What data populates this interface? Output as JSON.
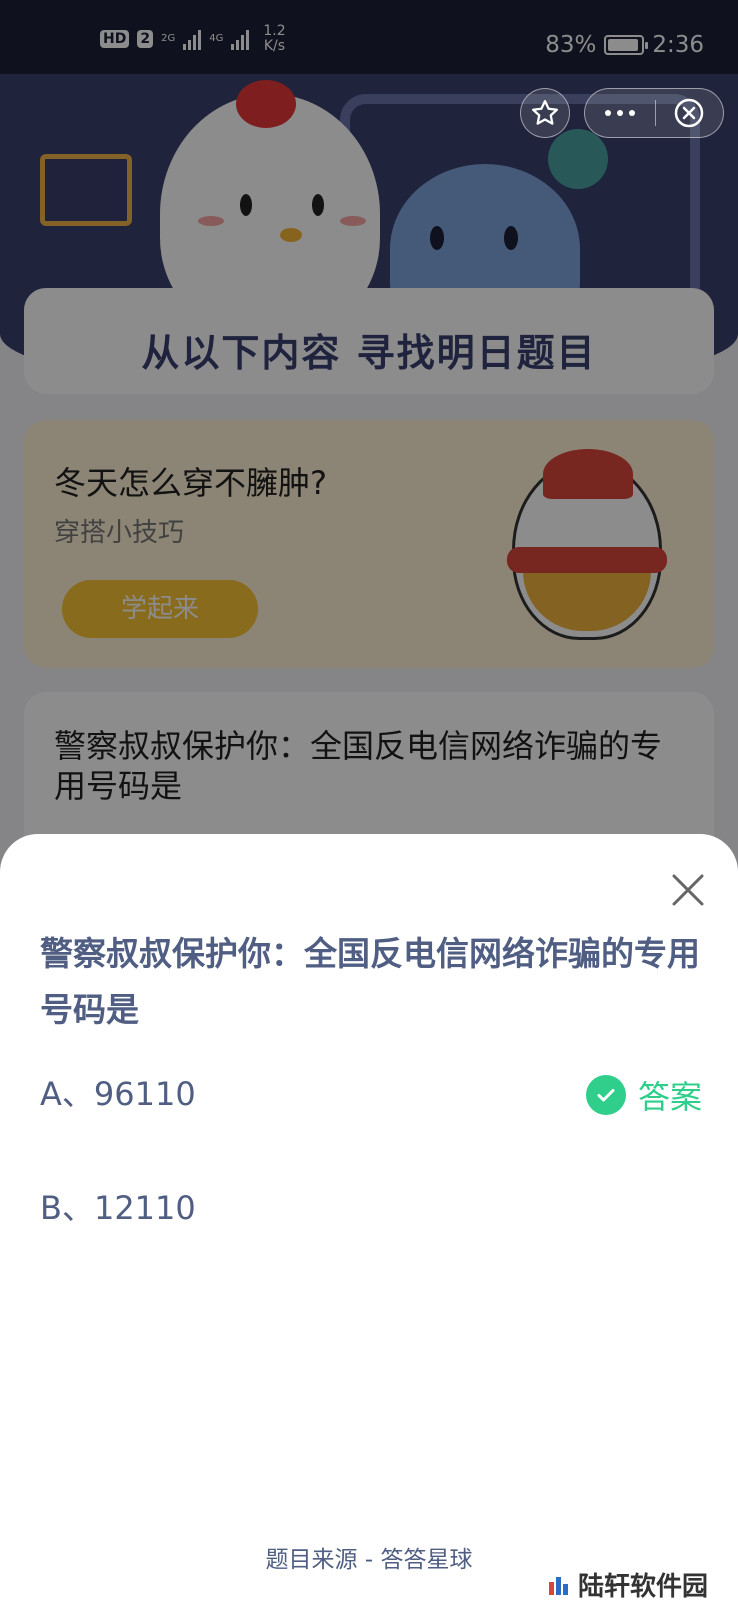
{
  "status_bar": {
    "hd": "HD",
    "sim": "2",
    "net1": "2G",
    "net2": "4G",
    "speed_value": "1.2",
    "speed_unit": "K/s",
    "battery": "83%",
    "time": "2:36"
  },
  "background": {
    "find_title": "从以下内容 寻找明日题目",
    "promo": {
      "title": "冬天怎么穿不臃肿?",
      "subtitle": "穿搭小技巧",
      "button": "学起来"
    },
    "question_card_text": "警察叔叔保护你：全国反电信网络诈骗的专用号码是"
  },
  "sheet": {
    "question": "警察叔叔保护你：全国反电信网络诈骗的专用号码是",
    "options": [
      {
        "label": "A、96110",
        "is_answer": true
      },
      {
        "label": "B、12110",
        "is_answer": false
      }
    ],
    "answer_label": "答案",
    "source": "题目来源 - 答答星球"
  },
  "watermark": "陆轩软件园",
  "colors": {
    "accent_green": "#2fcf8b",
    "text_slate": "#4f5e82",
    "hero_navy": "#39406c"
  },
  "icons": [
    "star-icon",
    "more-icon",
    "exit-icon",
    "close-icon",
    "check-icon",
    "battery-icon",
    "signal-icon"
  ]
}
